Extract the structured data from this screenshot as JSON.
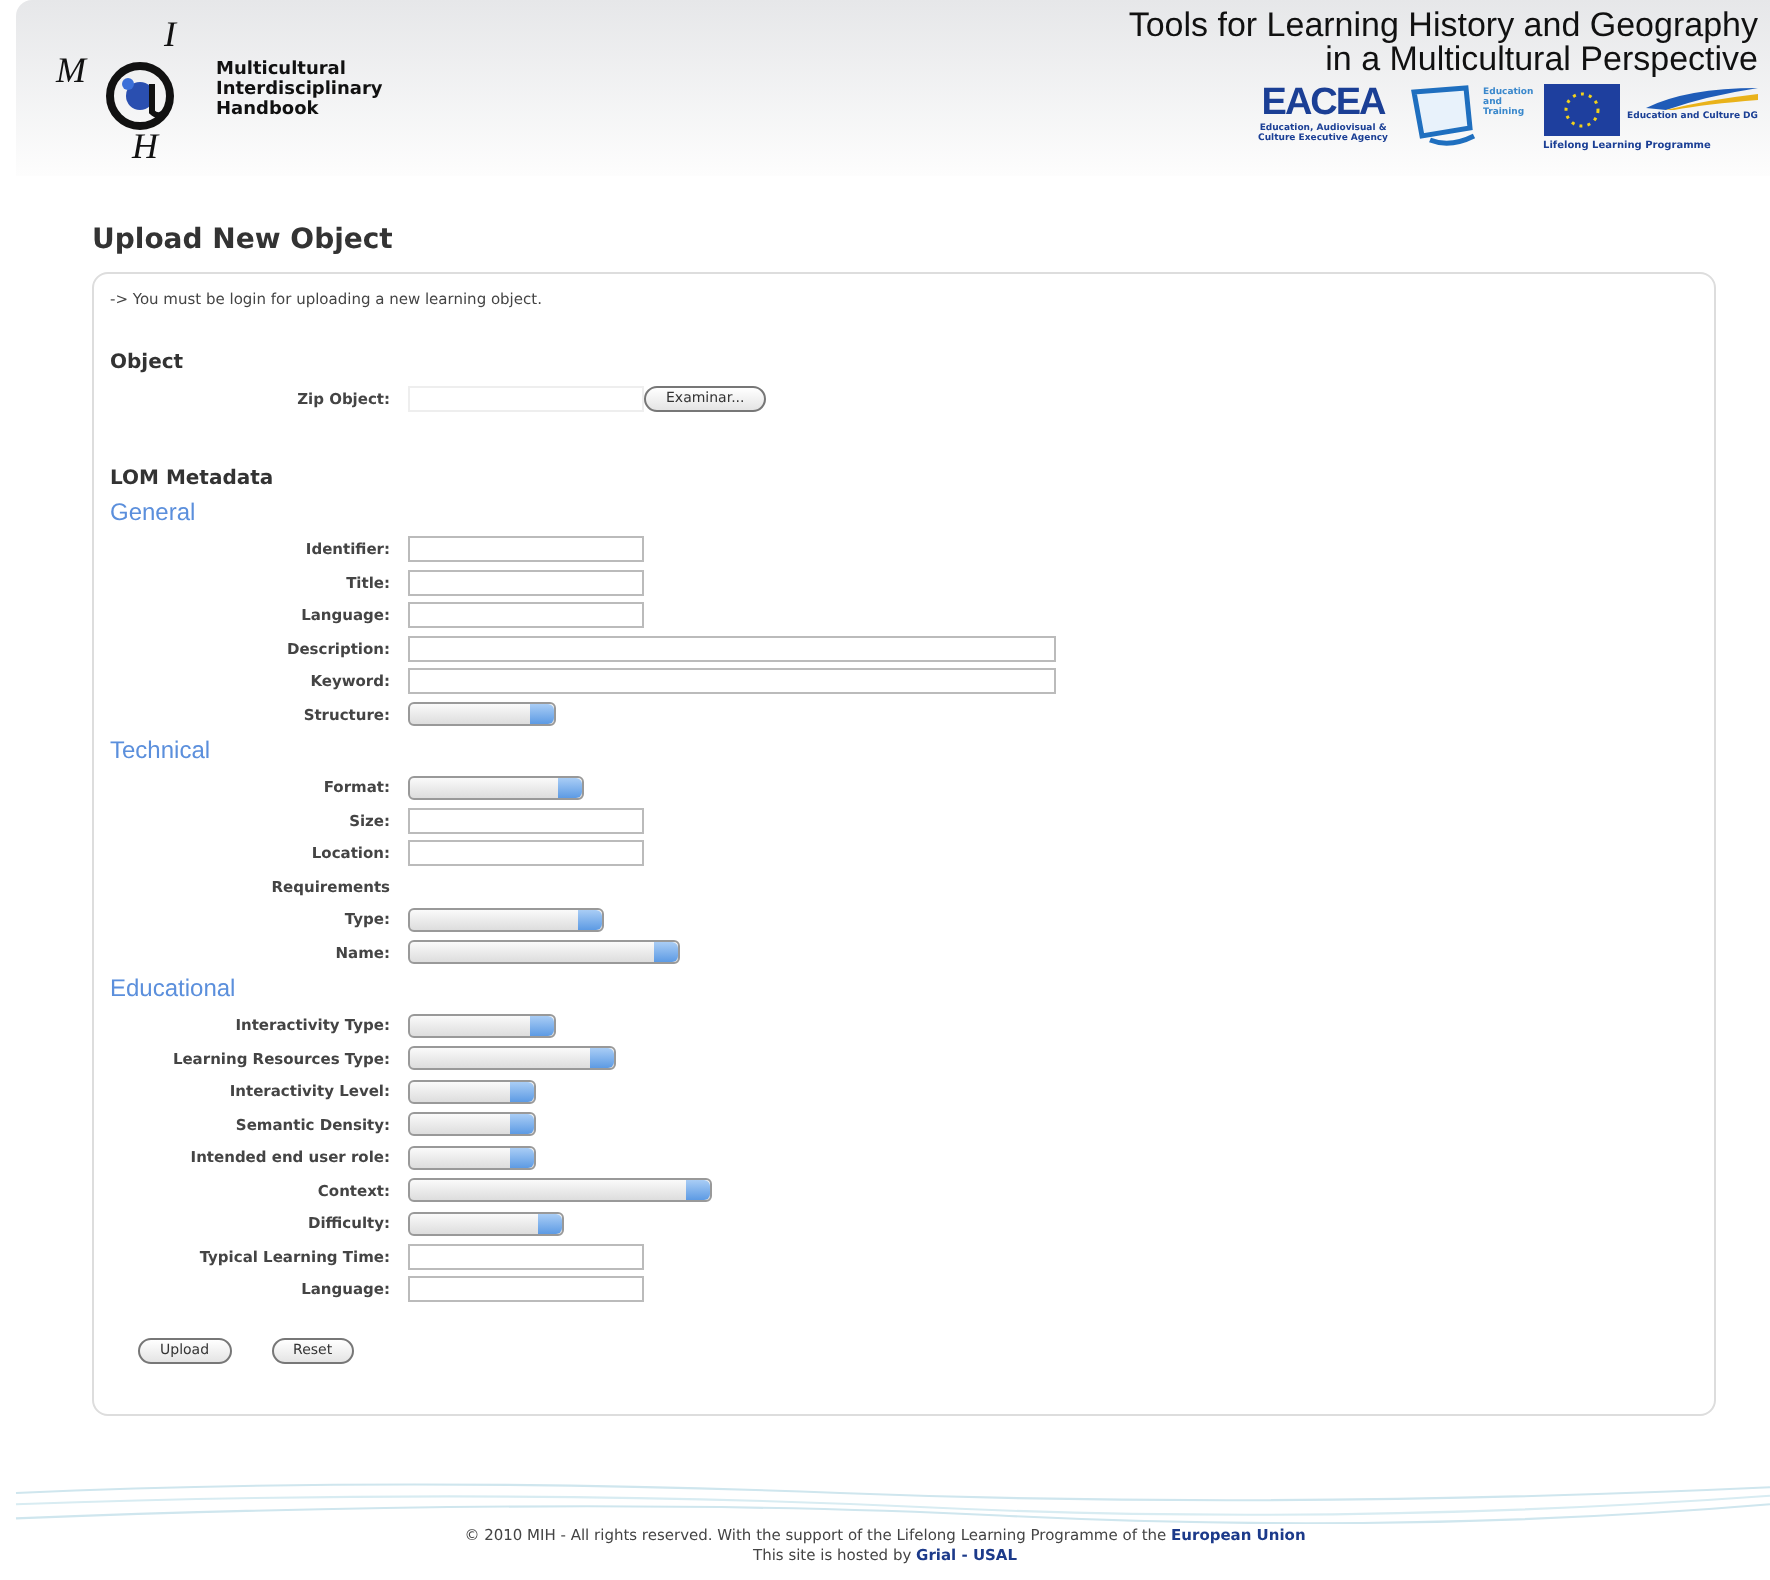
{
  "header": {
    "logo_letters": [
      "M",
      "I",
      "H"
    ],
    "logo_text": [
      "Multicultural",
      "Interdisciplinary",
      "Handbook"
    ],
    "tagline": [
      "Tools for Learning History and Geography",
      "in a Multicultural Perspective"
    ],
    "partners": [
      {
        "kind": "eacea",
        "text": "EACEA",
        "caption": "Education, Audiovisual & Culture Executive Agency"
      },
      {
        "kind": "training",
        "text": "Education and Training"
      },
      {
        "kind": "eu",
        "text": "Education and Culture DG",
        "caption": "Lifelong Learning Programme"
      }
    ]
  },
  "page_title": "Upload New Object",
  "notice": "-> You must be login for uploading a new learning object.",
  "object": {
    "heading": "Object",
    "label": "Zip Object:",
    "button": "Examinar..."
  },
  "metadata_heading": "LOM Metadata",
  "sections": [
    {
      "title": "General",
      "fields": [
        {
          "label": "Identifier:",
          "kind": "text"
        },
        {
          "label": "Title:",
          "kind": "text"
        },
        {
          "label": "Language:",
          "kind": "text"
        },
        {
          "label": "Description:",
          "kind": "wide"
        },
        {
          "label": "Keyword:",
          "kind": "wide"
        },
        {
          "label": "Structure:",
          "kind": "select"
        }
      ]
    },
    {
      "title": "Technical",
      "fields": [
        {
          "label": "Format:",
          "kind": "select"
        },
        {
          "label": "Size:",
          "kind": "text"
        },
        {
          "label": "Location:",
          "kind": "text"
        },
        {
          "label": "Requirements",
          "kind": "caption"
        },
        {
          "label": "Type:",
          "kind": "select"
        },
        {
          "label": "Name:",
          "kind": "select"
        }
      ]
    },
    {
      "title": "Educational",
      "fields": [
        {
          "label": "Interactivity Type:",
          "kind": "select"
        },
        {
          "label": "Learning Resources Type:",
          "kind": "select"
        },
        {
          "label": "Interactivity Level:",
          "kind": "select"
        },
        {
          "label": "Semantic Density:",
          "kind": "select"
        },
        {
          "label": "Intended end user role:",
          "kind": "select"
        },
        {
          "label": "Context:",
          "kind": "select"
        },
        {
          "label": "Difficulty:",
          "kind": "select"
        },
        {
          "label": "Typical Learning Time:",
          "kind": "text"
        },
        {
          "label": "Language:",
          "kind": "text"
        }
      ]
    }
  ],
  "buttons": [
    "Upload",
    "Reset"
  ],
  "footer": {
    "text": "© 2010 MIH - All rights reserved. With the support of the Lifelong Learning Programme of the ",
    "link": "European Union",
    "host_text": "This site is hosted by ",
    "host_link": "Grial - USAL"
  }
}
